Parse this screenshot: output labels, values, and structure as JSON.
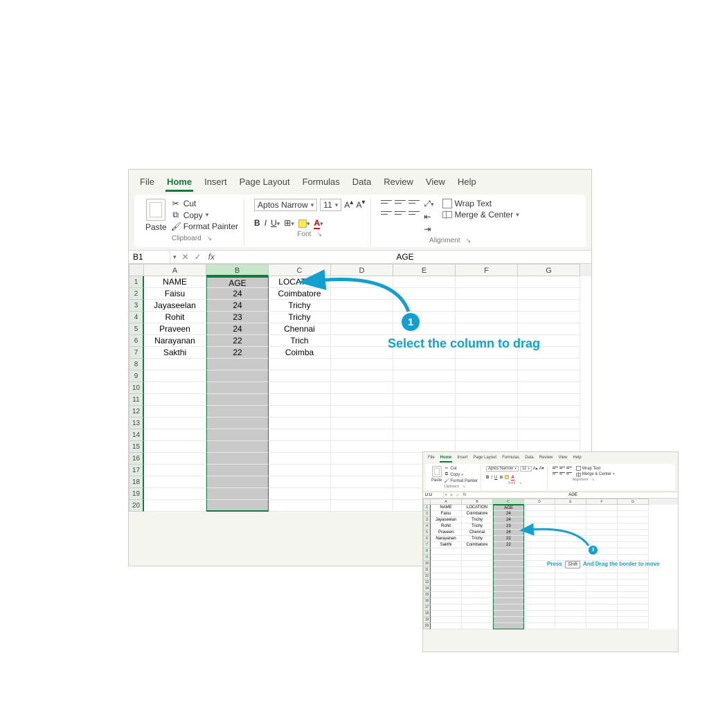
{
  "tabs": [
    "File",
    "Home",
    "Insert",
    "Page Layout",
    "Formulas",
    "Data",
    "Review",
    "View",
    "Help"
  ],
  "active_tab": "Home",
  "clipboard": {
    "paste": "Paste",
    "cut": "Cut",
    "copy": "Copy",
    "painter": "Format Painter",
    "label": "Clipboard"
  },
  "font": {
    "name": "Aptos Narrow",
    "size": "11",
    "label": "Font"
  },
  "alignment": {
    "wrap": "Wrap Text",
    "merge": "Merge & Center",
    "label": "Alignment"
  },
  "main": {
    "cell_ref": "B1",
    "formula": "AGE",
    "cols": [
      "A",
      "B",
      "C",
      "D",
      "E",
      "F",
      "G"
    ],
    "sel_col_index": 1,
    "rows": 20,
    "data": [
      [
        "NAME",
        "AGE",
        "LOCATION"
      ],
      [
        "Faisu",
        "24",
        "Coimbatore"
      ],
      [
        "Jayaseelan",
        "24",
        "Trichy"
      ],
      [
        "Rohit",
        "23",
        "Trichy"
      ],
      [
        "Praveen",
        "24",
        "Chennai"
      ],
      [
        "Narayanan",
        "22",
        "Trich"
      ],
      [
        "Sakthi",
        "22",
        "Coimba"
      ]
    ]
  },
  "mini": {
    "cell_ref": "D:D",
    "formula": "AGE",
    "cols": [
      "A",
      "B",
      "C",
      "D",
      "E",
      "F",
      "G"
    ],
    "sel_col_index": 2,
    "rows": 20,
    "data": [
      [
        "NAME",
        "LOCATION",
        "AGE"
      ],
      [
        "Faisu",
        "Coimbatore",
        "24"
      ],
      [
        "Jayaseelan",
        "Trichy",
        "24"
      ],
      [
        "Rohit",
        "Trichy",
        "23"
      ],
      [
        "Praveen",
        "Chennai",
        "24"
      ],
      [
        "Narayanan",
        "Trichy",
        "22"
      ],
      [
        "Sakthi",
        "Coimbatore",
        "22"
      ]
    ]
  },
  "callout1": {
    "num": "1",
    "text": "Select the column to drag"
  },
  "callout3": {
    "num": "3",
    "text_a": "Press",
    "key": "Shift",
    "text_b": "And Drag the border to move"
  }
}
